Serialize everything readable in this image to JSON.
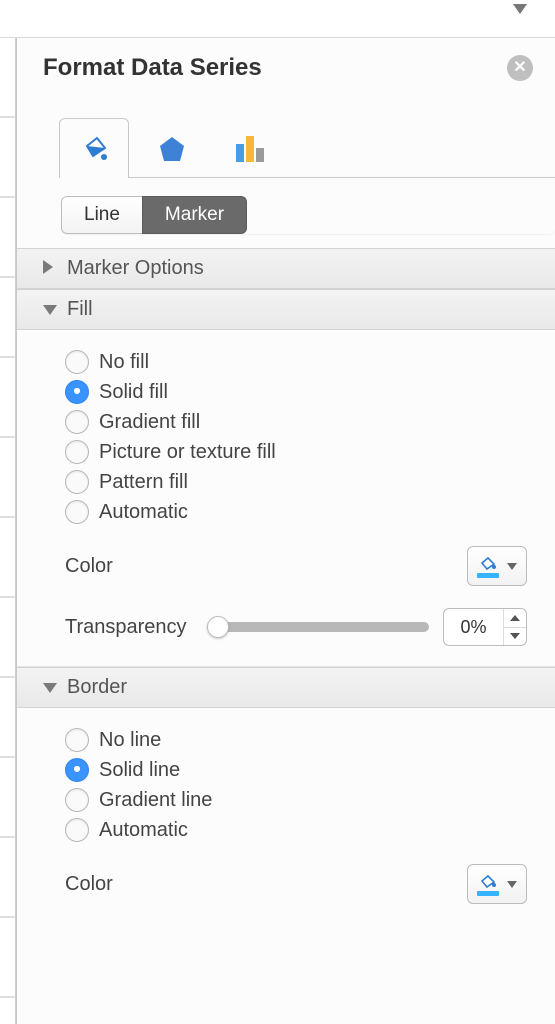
{
  "header": {
    "title": "Format Data Series"
  },
  "tabs": {
    "line_marker": {
      "line_label": "Line",
      "marker_label": "Marker",
      "active": "marker"
    }
  },
  "sections": {
    "marker_options": {
      "title": "Marker Options",
      "expanded": false
    },
    "fill": {
      "title": "Fill",
      "expanded": true,
      "options": [
        {
          "label": "No fill",
          "selected": false
        },
        {
          "label": "Solid fill",
          "selected": true
        },
        {
          "label": "Gradient fill",
          "selected": false
        },
        {
          "label": "Picture or texture fill",
          "selected": false
        },
        {
          "label": "Pattern fill",
          "selected": false
        },
        {
          "label": "Automatic",
          "selected": false
        }
      ],
      "color_label": "Color",
      "transparency_label": "Transparency",
      "transparency_value": "0%"
    },
    "border": {
      "title": "Border",
      "expanded": true,
      "options": [
        {
          "label": "No line",
          "selected": false
        },
        {
          "label": "Solid line",
          "selected": true
        },
        {
          "label": "Gradient line",
          "selected": false
        },
        {
          "label": "Automatic",
          "selected": false
        }
      ],
      "color_label": "Color"
    }
  }
}
